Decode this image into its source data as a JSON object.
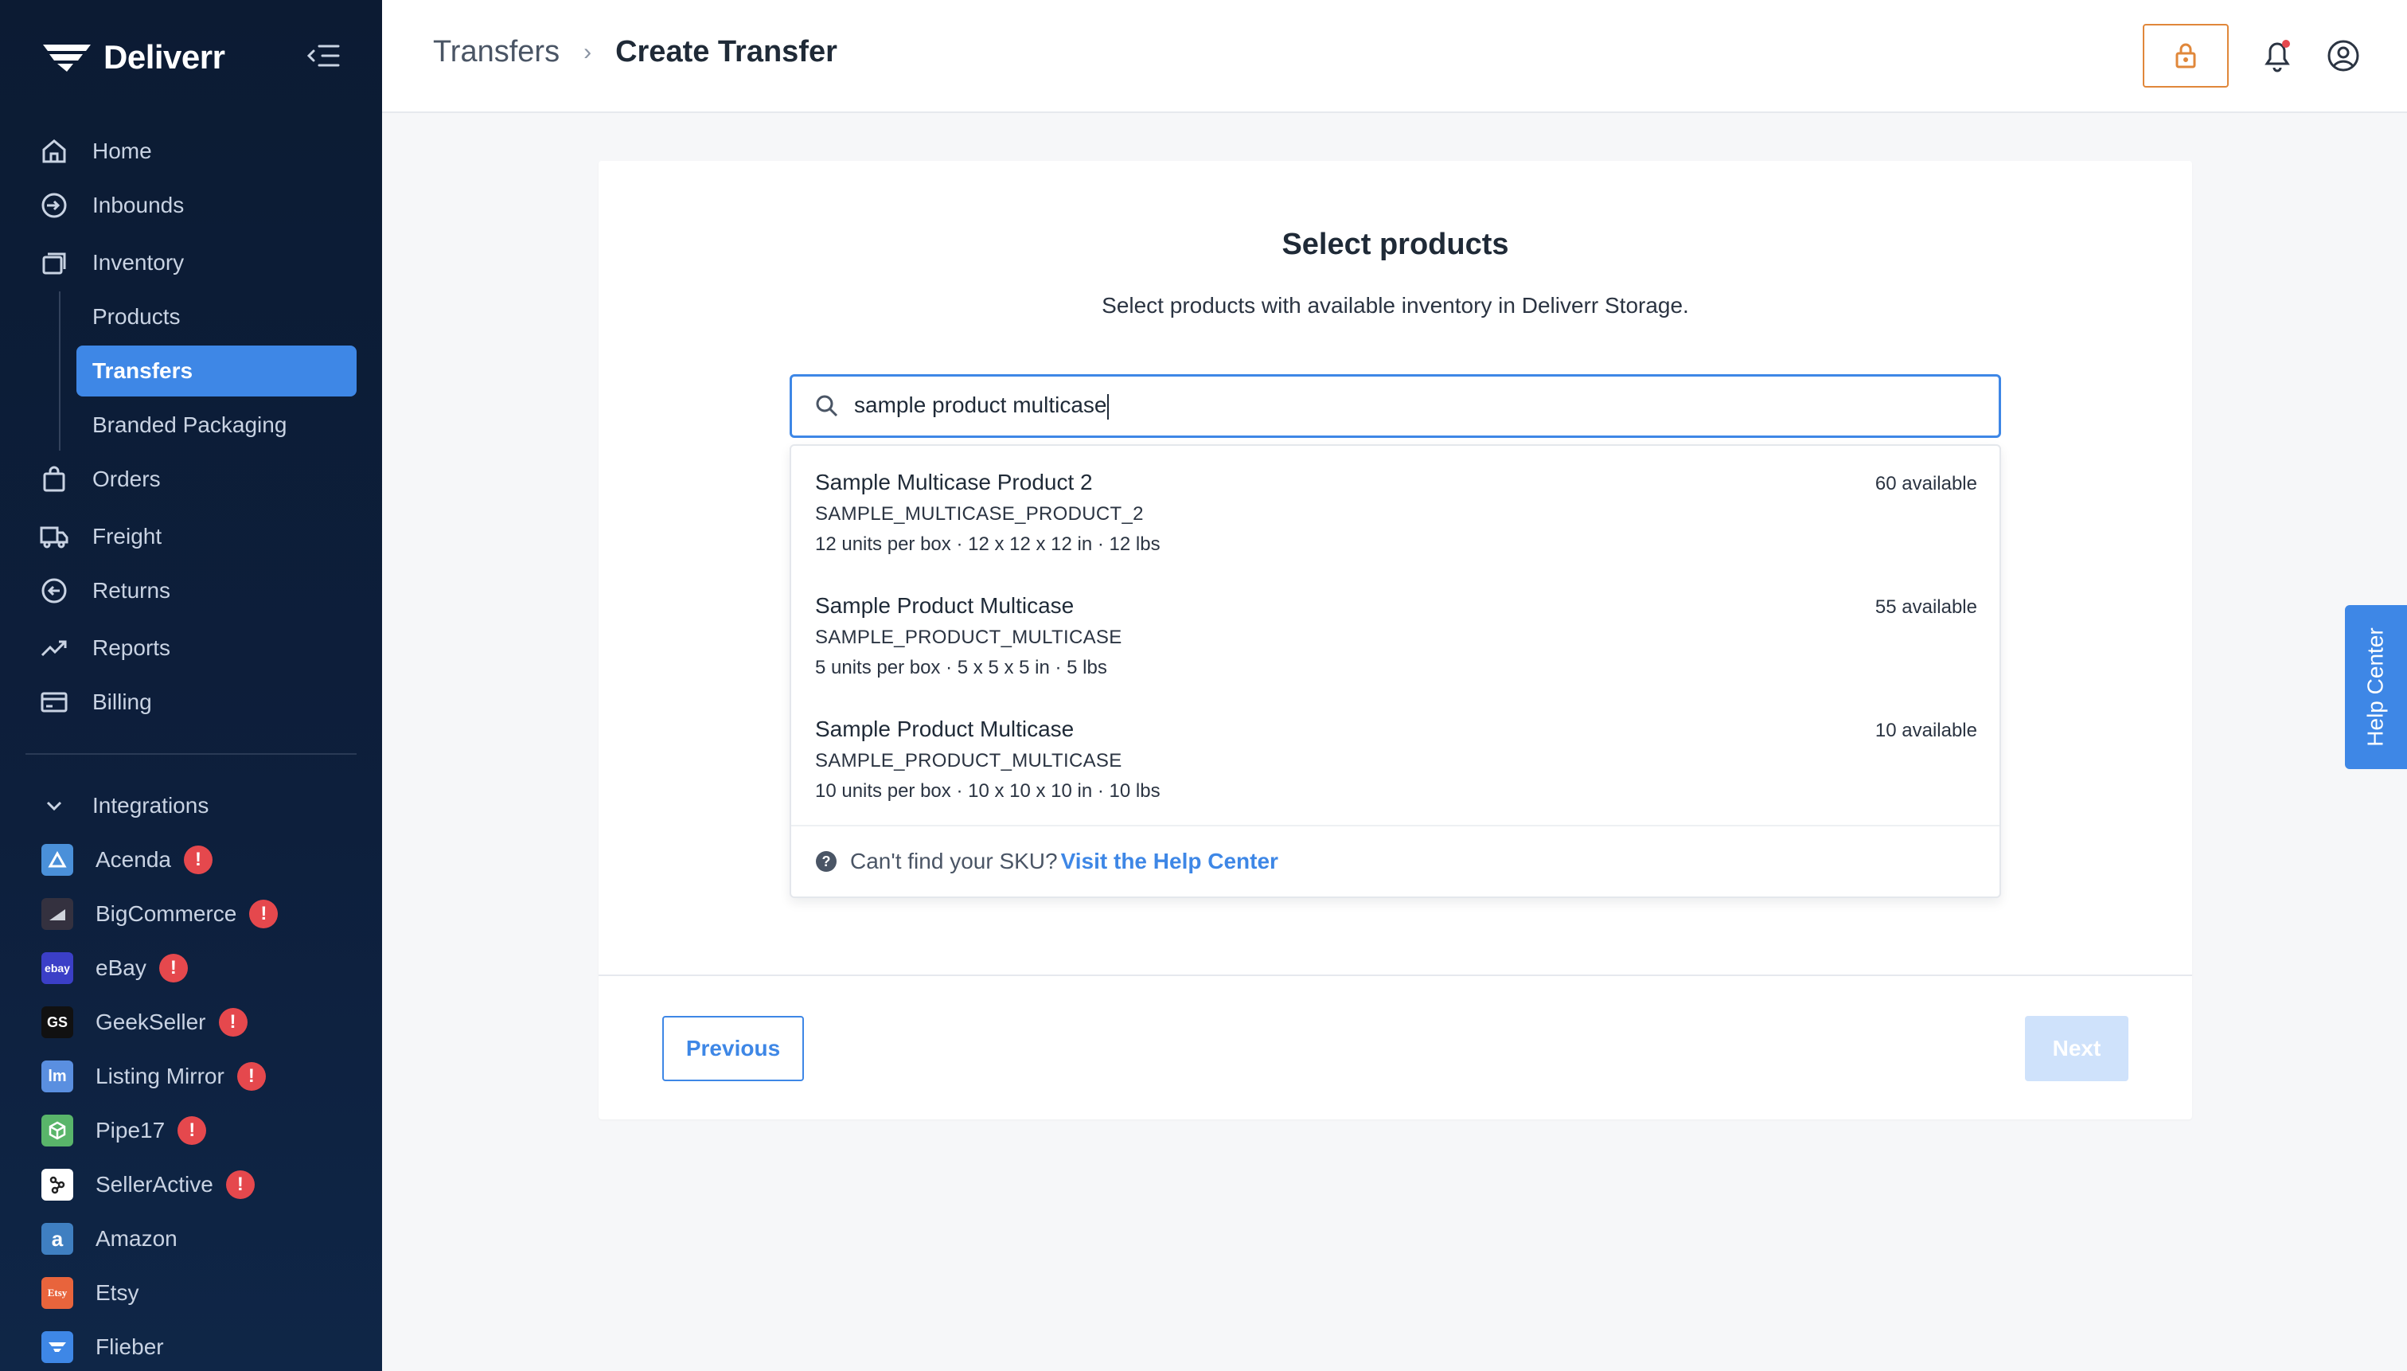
{
  "brand": {
    "name": "Deliverr"
  },
  "nav": {
    "home": "Home",
    "inbounds": "Inbounds",
    "inventory": "Inventory",
    "products": "Products",
    "transfers": "Transfers",
    "branded_packaging": "Branded Packaging",
    "orders": "Orders",
    "freight": "Freight",
    "returns": "Returns",
    "reports": "Reports",
    "billing": "Billing"
  },
  "integrations": {
    "header": "Integrations",
    "items": [
      {
        "label": "Acenda",
        "alert": true,
        "logo_text": "",
        "color": "#4a90d9"
      },
      {
        "label": "BigCommerce",
        "alert": true,
        "logo_text": "",
        "color": "#34313f"
      },
      {
        "label": "eBay",
        "alert": true,
        "logo_text": "ebay",
        "color": "#3b3fc7"
      },
      {
        "label": "GeekSeller",
        "alert": true,
        "logo_text": "GS",
        "color": "#111111"
      },
      {
        "label": "Listing Mirror",
        "alert": true,
        "logo_text": "lm",
        "color": "#5a8fe0"
      },
      {
        "label": "Pipe17",
        "alert": true,
        "logo_text": "",
        "color": "#59b56a"
      },
      {
        "label": "SellerActive",
        "alert": true,
        "logo_text": "",
        "color": "#ffffff"
      },
      {
        "label": "Amazon",
        "alert": false,
        "logo_text": "a",
        "color": "#3f7fc1"
      },
      {
        "label": "Etsy",
        "alert": false,
        "logo_text": "Etsy",
        "color": "#e8643c"
      },
      {
        "label": "Flieber",
        "alert": false,
        "logo_text": "",
        "color": "#3e87e6"
      }
    ]
  },
  "header": {
    "breadcrumb_parent": "Transfers",
    "breadcrumb_sep": "›",
    "breadcrumb_current": "Create Transfer"
  },
  "card": {
    "title": "Select products",
    "subtitle": "Select products with available inventory in Deliverr Storage.",
    "search_value": "sample product multicase",
    "results": [
      {
        "name": "Sample Multicase Product 2",
        "sku": "SAMPLE_MULTICASE_PRODUCT_2",
        "meta": "12 units per box · 12 x 12 x 12 in · 12 lbs",
        "available": "60 available"
      },
      {
        "name": "Sample Product Multicase",
        "sku": "SAMPLE_PRODUCT_MULTICASE",
        "meta": "5 units per box · 5 x 5 x 5 in · 5 lbs",
        "available": "55 available"
      },
      {
        "name": "Sample Product Multicase",
        "sku": "SAMPLE_PRODUCT_MULTICASE",
        "meta": "10 units per box · 10 x 10 x 10 in · 10 lbs",
        "available": "10 available"
      }
    ],
    "footer_text": "Can't find your SKU?",
    "footer_link": "Visit the Help Center",
    "previous": "Previous",
    "next": "Next"
  },
  "help_tab": "Help Center",
  "colors": {
    "accent": "#3e87e6",
    "sidebar": "#0c1b33",
    "alert": "#e5484d",
    "lock": "#e0873a"
  }
}
